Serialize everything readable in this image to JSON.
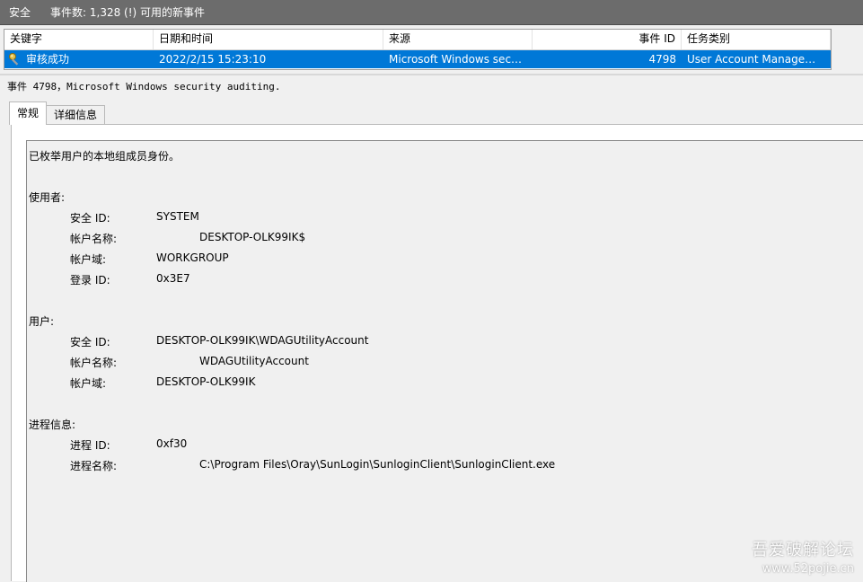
{
  "titlebar": {
    "title": "安全",
    "count": "事件数: 1,328 (!) 可用的新事件"
  },
  "grid": {
    "columns": [
      "关键字",
      "日期和时间",
      "来源",
      "事件 ID",
      "任务类别"
    ],
    "row": {
      "keyword": "审核成功",
      "datetime": "2022/2/15 15:23:10",
      "source": "Microsoft Windows secu...",
      "event_id": "4798",
      "category": "User Account Managem..."
    }
  },
  "detail": {
    "title": "事件 4798，Microsoft Windows security auditing."
  },
  "tabs": [
    "常规",
    "详细信息"
  ],
  "message": {
    "summary": "已枚举用户的本地组成员身份。",
    "subject_head": "使用者:",
    "subject": {
      "sid_label": "安全 ID:",
      "sid": "SYSTEM",
      "acct_label": "帐户名称:",
      "acct": "DESKTOP-OLK99IK$",
      "domain_label": "帐户域:",
      "domain": "WORKGROUP",
      "logon_label": "登录 ID:",
      "logon": "0x3E7"
    },
    "user_head": "用户:",
    "user": {
      "sid_label": "安全 ID:",
      "sid": "DESKTOP-OLK99IK\\WDAGUtilityAccount",
      "acct_label": "帐户名称:",
      "acct": "WDAGUtilityAccount",
      "domain_label": "帐户域:",
      "domain": "DESKTOP-OLK99IK"
    },
    "process_head": "进程信息:",
    "process": {
      "pid_label": "进程 ID:",
      "pid": "0xf30",
      "name_label": "进程名称:",
      "name": "C:\\Program Files\\Oray\\SunLogin\\SunloginClient\\SunloginClient.exe"
    }
  },
  "watermark": {
    "line1": "吾爱破解论坛",
    "line2": "www.52pojie.cn"
  },
  "colors": {
    "selection": "#0078d7",
    "titlebar": "#6c6c6c"
  }
}
